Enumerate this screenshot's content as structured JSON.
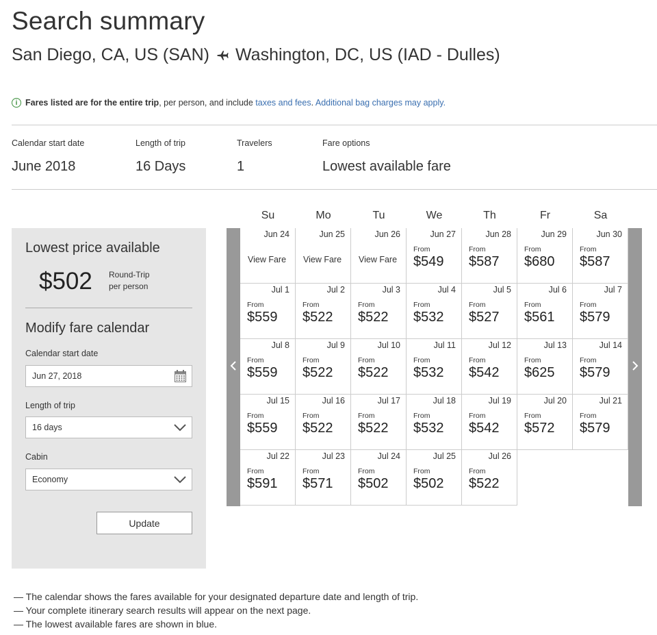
{
  "page_title": "Search summary",
  "route": {
    "origin": "San Diego, CA, US (SAN)",
    "destination": "Washington, DC, US (IAD - Dulles)"
  },
  "notice": {
    "bold": "Fares listed are for the entire trip",
    "middle": ", per person, and include ",
    "link1": "taxes and fees",
    "dot": ".",
    "link2": "Additional bag charges may apply."
  },
  "summary": [
    {
      "label": "Calendar start date",
      "value": "June 2018"
    },
    {
      "label": "Length of trip",
      "value": "16 Days"
    },
    {
      "label": "Travelers",
      "value": "1"
    },
    {
      "label": "Fare options",
      "value": "Lowest available fare"
    }
  ],
  "days_of_week": [
    "Su",
    "Mo",
    "Tu",
    "We",
    "Th",
    "Fr",
    "Sa"
  ],
  "panel": {
    "lowest_title": "Lowest price available",
    "lowest_price": "$502",
    "price_note1": "Round-Trip",
    "price_note2": "per person",
    "modify_title": "Modify fare calendar",
    "start_label": "Calendar start date",
    "start_value": "Jun 27, 2018",
    "length_label": "Length of trip",
    "length_value": "16 days",
    "cabin_label": "Cabin",
    "cabin_value": "Economy",
    "update_label": "Update"
  },
  "calendar": {
    "from_label": "From",
    "view_fare_label": "View Fare",
    "weeks": [
      [
        {
          "date": "Jun 24",
          "price": null
        },
        {
          "date": "Jun 25",
          "price": null
        },
        {
          "date": "Jun 26",
          "price": null
        },
        {
          "date": "Jun 27",
          "price": "$549"
        },
        {
          "date": "Jun 28",
          "price": "$587"
        },
        {
          "date": "Jun 29",
          "price": "$680"
        },
        {
          "date": "Jun 30",
          "price": "$587"
        }
      ],
      [
        {
          "date": "Jul 1",
          "price": "$559"
        },
        {
          "date": "Jul 2",
          "price": "$522"
        },
        {
          "date": "Jul 3",
          "price": "$522"
        },
        {
          "date": "Jul 4",
          "price": "$532"
        },
        {
          "date": "Jul 5",
          "price": "$527"
        },
        {
          "date": "Jul 6",
          "price": "$561"
        },
        {
          "date": "Jul 7",
          "price": "$579"
        }
      ],
      [
        {
          "date": "Jul 8",
          "price": "$559"
        },
        {
          "date": "Jul 9",
          "price": "$522"
        },
        {
          "date": "Jul 10",
          "price": "$522"
        },
        {
          "date": "Jul 11",
          "price": "$532"
        },
        {
          "date": "Jul 12",
          "price": "$542"
        },
        {
          "date": "Jul 13",
          "price": "$625"
        },
        {
          "date": "Jul 14",
          "price": "$579"
        }
      ],
      [
        {
          "date": "Jul 15",
          "price": "$559"
        },
        {
          "date": "Jul 16",
          "price": "$522"
        },
        {
          "date": "Jul 17",
          "price": "$522"
        },
        {
          "date": "Jul 18",
          "price": "$532"
        },
        {
          "date": "Jul 19",
          "price": "$542"
        },
        {
          "date": "Jul 20",
          "price": "$572"
        },
        {
          "date": "Jul 21",
          "price": "$579"
        }
      ],
      [
        {
          "date": "Jul 22",
          "price": "$591"
        },
        {
          "date": "Jul 23",
          "price": "$571"
        },
        {
          "date": "Jul 24",
          "price": "$502"
        },
        {
          "date": "Jul 25",
          "price": "$502"
        },
        {
          "date": "Jul 26",
          "price": "$522"
        }
      ]
    ]
  },
  "notes": [
    "— The calendar shows the fares available for your designated departure date and length of trip.",
    "— Your complete itinerary search results will appear on the next page.",
    "— The lowest available fares are shown in blue."
  ]
}
